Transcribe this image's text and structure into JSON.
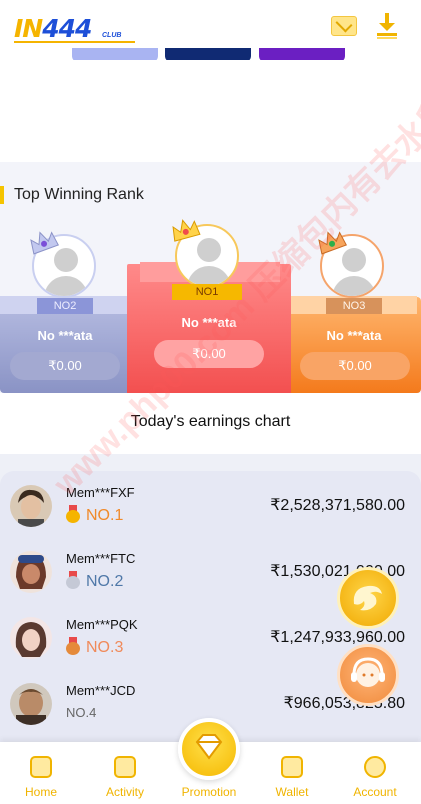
{
  "header": {
    "logo_main_prefix": "IN",
    "logo_main_number": "444",
    "logo_sub": "CLUB"
  },
  "rank": {
    "title": "Top Winning Rank",
    "podium": [
      {
        "position": "NO2",
        "name": "No ***ata",
        "amount": "₹0.00"
      },
      {
        "position": "NO1",
        "name": "No ***ata",
        "amount": "₹0.00"
      },
      {
        "position": "NO3",
        "name": "No ***ata",
        "amount": "₹0.00"
      }
    ],
    "chart_title": "Today's earnings chart"
  },
  "earnings": [
    {
      "name": "Mem***FXF",
      "rank": "NO.1",
      "amount": "₹2,528,371,580.00",
      "rank_color": "#f08a2a"
    },
    {
      "name": "Mem***FTC",
      "rank": "NO.2",
      "amount": "₹1,530,021,000.00",
      "rank_color": "#4f78a8"
    },
    {
      "name": "Mem***PQK",
      "rank": "NO.3",
      "amount": "₹1,247,933,960.00",
      "rank_color": "#f08a5a"
    },
    {
      "name": "Mem***JCD",
      "rank": "NO.4",
      "amount": "₹966,053,825.80",
      "rank_color": "#666666"
    }
  ],
  "nav": {
    "home": "Home",
    "activity": "Activity",
    "promotion": "Promotion",
    "wallet": "Wallet",
    "account": "Account"
  },
  "watermark": "www.php00.com 压缩包内有去水印图片",
  "colors": {
    "accent": "#f5c400",
    "gold": "#f0b400"
  }
}
